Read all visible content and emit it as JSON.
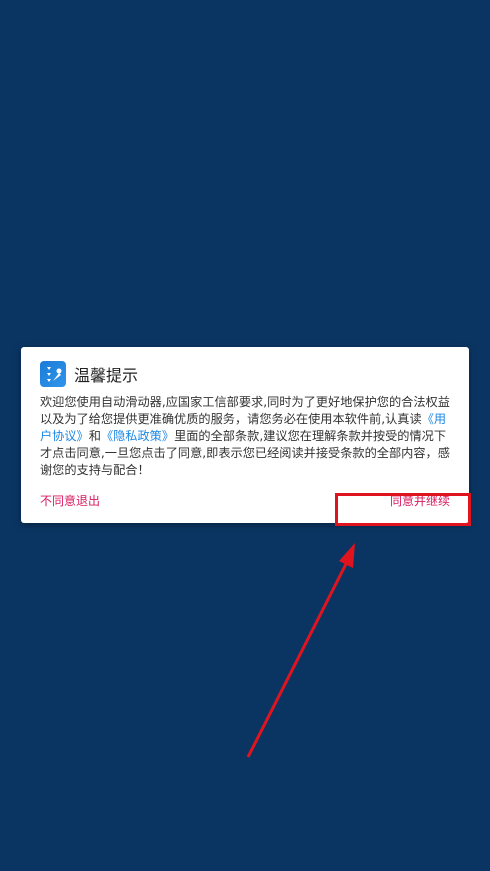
{
  "dialog": {
    "title": "温馨提示",
    "text_1": "欢迎您使用自动滑动器,应国家工信部要求,同时为了更好地保护您的合法权益以及为了给您提供更准确优质的服务，请您务必在使用本软件前,认真读",
    "link_user_agreement": "《用户协议》",
    "text_and": "和",
    "link_privacy_policy": "《隐私政策》",
    "text_2": "里面的全部条款,建议您在理解条款并按受的情况下才点击同意,一旦您点击了同意,即表示您已经阅读并接受条款的全部内容，感谢您的支持与配合！",
    "disagree_label": "不同意退出",
    "agree_label": "同意并继续"
  },
  "colors": {
    "background": "#0a3563",
    "link": "#1e88e5",
    "button_text": "#d81b60",
    "annotation": "#e0141e"
  },
  "icons": {
    "app_icon": "app-logo-icon"
  }
}
